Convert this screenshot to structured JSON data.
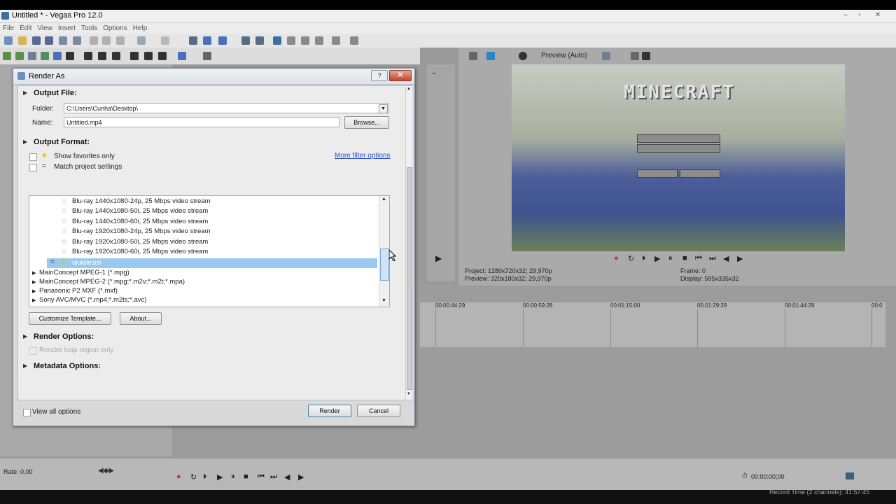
{
  "app": {
    "title": "Untitled * - Vegas Pro 12.0",
    "menu": [
      "File",
      "Edit",
      "View",
      "Insert",
      "Tools",
      "Options",
      "Help"
    ]
  },
  "preview": {
    "mode_label": "Preview (Auto)",
    "image_logo_text": "MINECRAFT",
    "project_label": "Project:",
    "project_value": "1280x720x32; 29,970p",
    "preview_label": "Preview:",
    "preview_value": "320x180x32; 29,970p",
    "frame_label": "Frame:",
    "frame_value": "0",
    "display_label": "Display:",
    "display_value": "595x335x32"
  },
  "timeline": {
    "ticks": [
      "00:00:44:29",
      "00:00:59:28",
      "00:01:15:00",
      "00:01:29:29",
      "00:01:44:29",
      "00:0"
    ],
    "timecode": "00:00:00;00",
    "rate_label": "Rate: 0,00",
    "record_time": "Record Time (2 channels): 41:57:45"
  },
  "dialog": {
    "title": "Render As",
    "help_label": "?",
    "close_label": "✕",
    "output_file": {
      "heading": "Output File:",
      "folder_label": "Folder:",
      "folder_value": "C:\\Users\\Cunha\\Desktop\\",
      "name_label": "Name:",
      "name_value": "Untitled.mp4",
      "browse_label": "Browse..."
    },
    "output_format": {
      "heading": "Output Format:",
      "show_favorites": "Show favorites only",
      "match_project": "Match project settings",
      "more_filter": "More filter options",
      "templates": [
        "Blu-ray 1440x1080-24p, 25 Mbps video stream",
        "Blu-ray 1440x1080-50i, 25 Mbps video stream",
        "Blu-ray 1440x1080-60i, 25 Mbps video stream",
        "Blu-ray 1920x1080-24p, 25 Mbps video stream",
        "Blu-ray 1920x1080-50i, 25 Mbps video stream",
        "Blu-ray 1920x1080-60i, 25 Mbps video stream"
      ],
      "selected_template": "uiuialesisi",
      "formats": [
        "MainConcept MPEG-1 (*.mpg)",
        "MainConcept MPEG-2 (*.mpg;*.m2v;*.m2t;*.mpa)",
        "Panasonic P2 MXF (*.mxf)",
        "Sony AVC/MVC (*.mp4;*.m2ts;*.avc)"
      ],
      "customize_label": "Customize Template...",
      "about_label": "About..."
    },
    "render_options": {
      "heading": "Render Options:",
      "loop_region": "Render loop region only"
    },
    "metadata_options": {
      "heading": "Metadata Options:"
    },
    "footer": {
      "view_all": "View all options",
      "render_label": "Render",
      "cancel_label": "Cancel"
    }
  }
}
